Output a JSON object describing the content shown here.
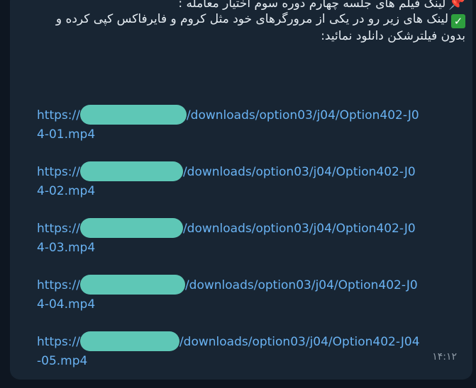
{
  "message": {
    "line1": "لینک فیلم های جلسه چهارم دوره سوم اختیار معامله :",
    "line2": "لینک های زیر رو در یکی از مرورگرهای خود مثل کروم و فایرفاکس کپی کرده و",
    "line3": "بدون فیلترشکن دانلود نمائید:",
    "pin_icon": "pushpin-icon",
    "check_icon": "check-mark-button-icon",
    "check_symbol": "✓",
    "pin_symbol": "📌"
  },
  "links": [
    {
      "prefix": "https://",
      "suffix": "/downloads/option03/j04/Option402-J04-01.mp4"
    },
    {
      "prefix": "https://",
      "suffix": "/downloads/option03/j04/Option402-J04-02.mp4"
    },
    {
      "prefix": "https://",
      "suffix": "/downloads/option03/j04/Option402-J04-03.mp4"
    },
    {
      "prefix": "https://",
      "suffix": "/downloads/option03/j04/Option402-J04-04.mp4"
    },
    {
      "prefix": "https://",
      "suffix": "/downloads/option03/j04/Option402-J04-05.mp4"
    }
  ],
  "timestamp": "۱۴:۱۲",
  "colors": {
    "background": "#0e1621",
    "bubble": "#182533",
    "link": "#6ab3f3",
    "redaction": "#5ec7b6",
    "text": "#e6edf3"
  }
}
